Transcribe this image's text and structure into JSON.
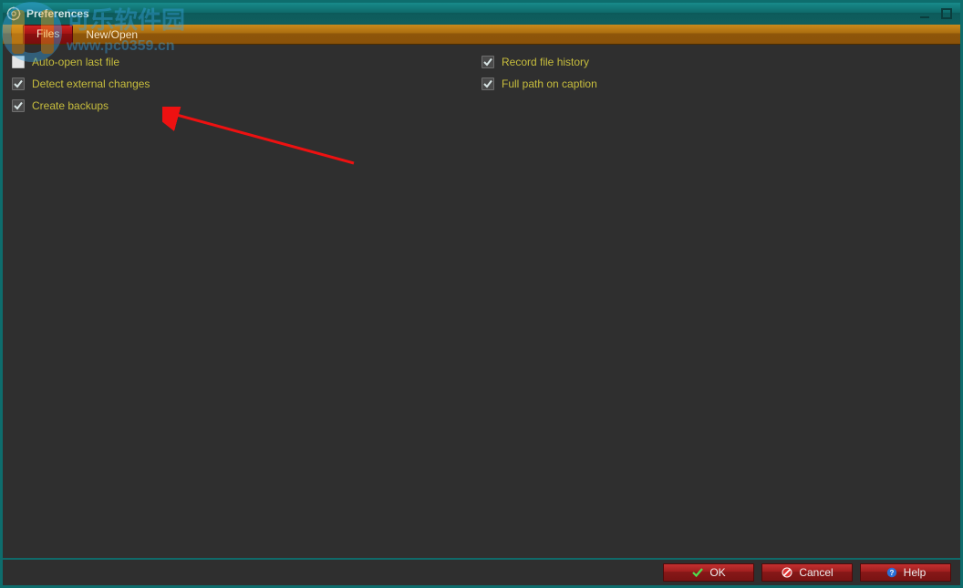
{
  "window": {
    "title": "Preferences"
  },
  "tabs": {
    "hidden": "",
    "files": "Files",
    "newopen": "New/Open"
  },
  "options": {
    "left": [
      {
        "label": "Auto-open last file",
        "checked": false
      },
      {
        "label": "Detect external changes",
        "checked": true
      },
      {
        "label": "Create backups",
        "checked": true
      }
    ],
    "right": [
      {
        "label": "Record file history",
        "checked": true
      },
      {
        "label": "Full path on caption",
        "checked": true
      }
    ]
  },
  "buttons": {
    "ok": "OK",
    "cancel": "Cancel",
    "help": "Help"
  },
  "watermark": {
    "line1": "可乐软件园",
    "line2": "www.pc0359.cn"
  }
}
